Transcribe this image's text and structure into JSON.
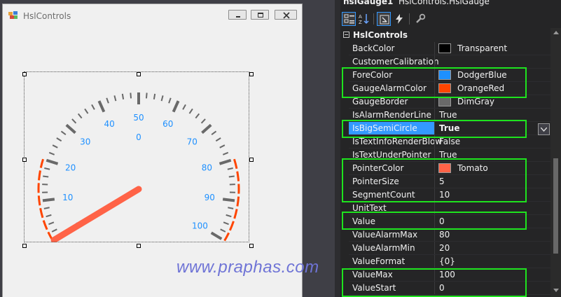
{
  "form": {
    "title": "HslControls"
  },
  "gauge": {
    "center_text": "0",
    "value": 0,
    "value_start": 0,
    "value_max": 100,
    "segment_count": 10,
    "pointer_color": "#ff6347",
    "fore_color": "#1e90ff",
    "alarm_color": "#ff4500",
    "border_color": "#696969",
    "scale_labels": [
      "0",
      "10",
      "20",
      "30",
      "40",
      "50",
      "60",
      "70",
      "80",
      "90",
      "100"
    ]
  },
  "watermark": "www.praphas.com",
  "property_grid": {
    "object_name": "hslGauge1",
    "object_type": "HslControls.HslGauge",
    "category": "HslControls",
    "toolbar_icons": [
      "categorized-icon",
      "alphabetical-icon",
      "properties-icon",
      "events-icon",
      "property-pages-icon"
    ],
    "rows": [
      {
        "name": "BackColor",
        "value": "Transparent",
        "swatch": "#000000"
      },
      {
        "name": "CustomerCalibration",
        "value": ""
      },
      {
        "name": "ForeColor",
        "value": "DodgerBlue",
        "swatch": "#1e90ff"
      },
      {
        "name": "GaugeAlarmColor",
        "value": "OrangeRed",
        "swatch": "#ff4500"
      },
      {
        "name": "GaugeBorder",
        "value": "DimGray",
        "swatch": "#696969"
      },
      {
        "name": "IsAlarmRenderLine",
        "value": "True"
      },
      {
        "name": "IsBigSemiCircle",
        "value": "True",
        "selected": true,
        "bold": true
      },
      {
        "name": "IsTextInfoRenderBlow",
        "value": "False"
      },
      {
        "name": "IsTextUnderPointer",
        "value": "True"
      },
      {
        "name": "PointerColor",
        "value": "Tomato",
        "swatch": "#ff6347"
      },
      {
        "name": "PointerSize",
        "value": "5"
      },
      {
        "name": "SegmentCount",
        "value": "10"
      },
      {
        "name": "UnitText",
        "value": ""
      },
      {
        "name": "Value",
        "value": "0"
      },
      {
        "name": "ValueAlarmMax",
        "value": "80"
      },
      {
        "name": "ValueAlarmMin",
        "value": "20"
      },
      {
        "name": "ValueFormat",
        "value": "{0}"
      },
      {
        "name": "ValueMax",
        "value": "100"
      },
      {
        "name": "ValueStart",
        "value": "0"
      }
    ]
  }
}
